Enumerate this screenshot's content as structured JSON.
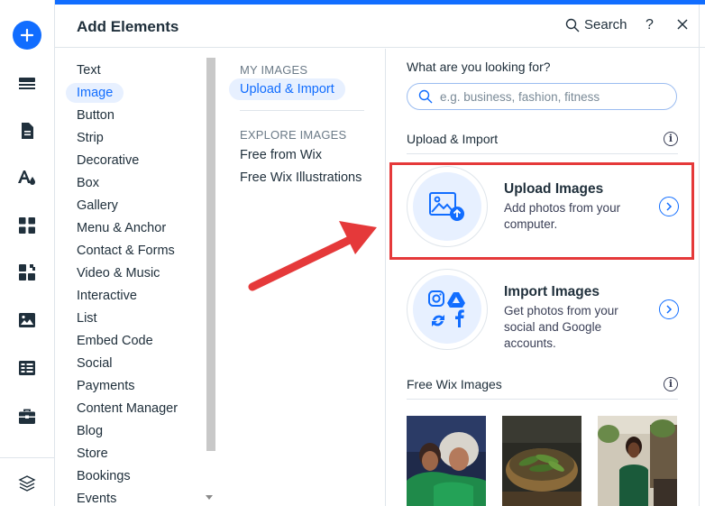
{
  "panel": {
    "title": "Add Elements",
    "search_label": "Search",
    "help_label": "?"
  },
  "categories": [
    {
      "label": "Text",
      "active": false
    },
    {
      "label": "Image",
      "active": true
    },
    {
      "label": "Button",
      "active": false
    },
    {
      "label": "Strip",
      "active": false
    },
    {
      "label": "Decorative",
      "active": false
    },
    {
      "label": "Box",
      "active": false
    },
    {
      "label": "Gallery",
      "active": false
    },
    {
      "label": "Menu & Anchor",
      "active": false
    },
    {
      "label": "Contact & Forms",
      "active": false
    },
    {
      "label": "Video & Music",
      "active": false
    },
    {
      "label": "Interactive",
      "active": false
    },
    {
      "label": "List",
      "active": false
    },
    {
      "label": "Embed Code",
      "active": false
    },
    {
      "label": "Social",
      "active": false
    },
    {
      "label": "Payments",
      "active": false
    },
    {
      "label": "Content Manager",
      "active": false
    },
    {
      "label": "Blog",
      "active": false
    },
    {
      "label": "Store",
      "active": false
    },
    {
      "label": "Bookings",
      "active": false
    },
    {
      "label": "Events",
      "active": false
    }
  ],
  "subcategories": {
    "my_images_heading": "MY IMAGES",
    "upload_import": "Upload & Import",
    "explore_heading": "EXPLORE IMAGES",
    "free_from_wix": "Free from Wix",
    "free_illustrations": "Free Wix Illustrations"
  },
  "content": {
    "question": "What are you looking for?",
    "search_placeholder": "e.g. business, fashion, fitness",
    "upload_section_title": "Upload & Import",
    "upload_card": {
      "title": "Upload Images",
      "description": "Add photos from your computer."
    },
    "import_card": {
      "title": "Import Images",
      "description": "Get photos from your social and Google accounts."
    },
    "free_section_title": "Free Wix Images"
  },
  "colors": {
    "accent": "#116dff",
    "highlight": "#e5393a",
    "annotation_arrow": "#e5393a"
  },
  "icons": {
    "toolbar": [
      "add-icon",
      "sections-icon",
      "pages-icon",
      "theme-icon",
      "apps-icon",
      "business-icon",
      "media-icon",
      "cms-icon",
      "portfolio-icon",
      "layers-icon"
    ]
  }
}
